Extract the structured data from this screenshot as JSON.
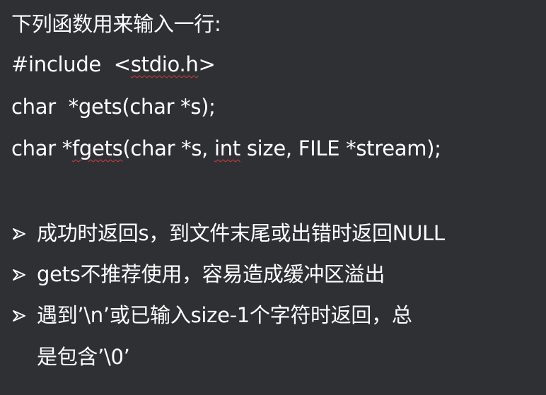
{
  "slide": {
    "heading": "下列函数用来输入一行:",
    "code": {
      "include_prefix": "#include  <",
      "include_header": "stdio.h",
      "include_suffix": ">",
      "gets_decl": "char  *gets(char *s);",
      "fgets_prefix": "char *",
      "fgets_name": "fgets",
      "fgets_mid": "(char *s, ",
      "fgets_int": "int",
      "fgets_suffix": " size, FILE *stream);"
    },
    "bullets": [
      "成功时返回s，到文件末尾或出错时返回NULL",
      "gets不推荐使用，容易造成缓冲区溢出",
      "遇到’\\n’或已输入size-1个字符时返回，总"
    ],
    "bullet_continuation": "是包含’\\0’",
    "colors": {
      "background": "#2f3034",
      "text": "#ffffff",
      "spellcheck_underline": "#d43c3c"
    },
    "icons": {
      "bullet": "arrowhead-bullet-icon"
    }
  }
}
